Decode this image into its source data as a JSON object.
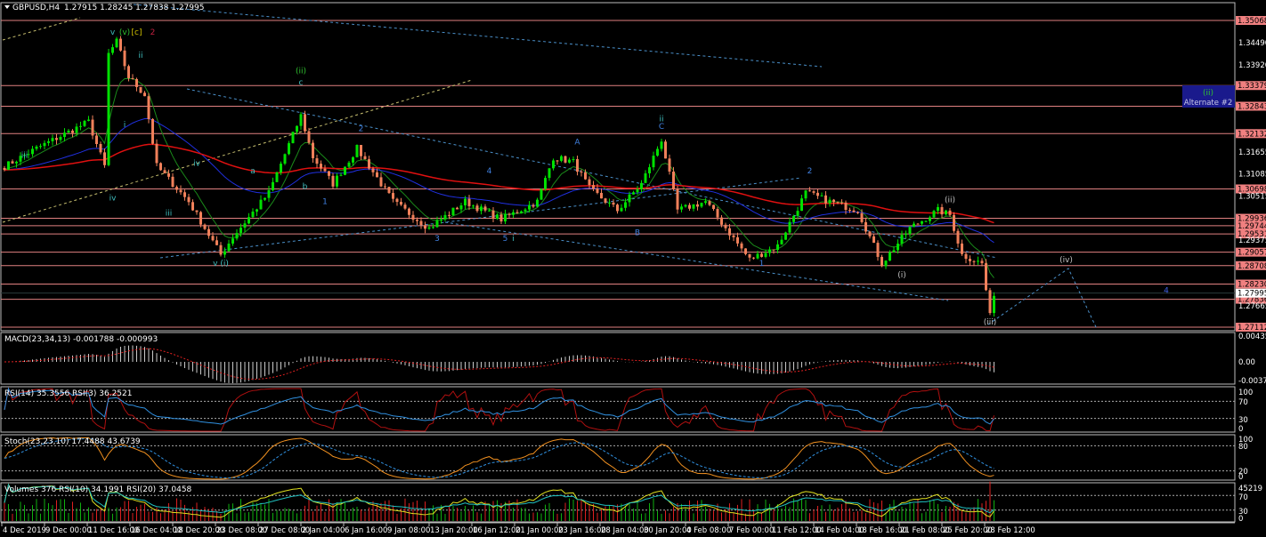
{
  "window": {
    "title": "GBPUSD,H4",
    "ohlc": "1.27915 1.28245 1.27838 1.27995",
    "menu_icon": "triangle-down-icon"
  },
  "colors": {
    "background": "#000000",
    "bull": "#00e000",
    "bear": "#f0805a",
    "level_line": "#e08080",
    "level_label_bg": "#f08080",
    "ma_fast": "#1a8a1a",
    "ma_mid": "#2030e0",
    "ma_slow": "#e01010",
    "alt_box": "#1a1a8c"
  },
  "chart_data": {
    "type": "candlestick",
    "symbol": "GBPUSD",
    "timeframe": "H4",
    "ylim": [
      1.27,
      1.356
    ],
    "price_waypoints": [
      [
        0,
        1.3128
      ],
      [
        8,
        1.3175
      ],
      [
        21,
        1.3244
      ],
      [
        25,
        1.3128
      ],
      [
        26,
        1.342
      ],
      [
        28,
        1.3452
      ],
      [
        31,
        1.336
      ],
      [
        35,
        1.3314
      ],
      [
        38,
        1.3129
      ],
      [
        46,
        1.3037
      ],
      [
        54,
        1.2899
      ],
      [
        57,
        1.2945
      ],
      [
        66,
        1.306
      ],
      [
        74,
        1.326
      ],
      [
        77,
        1.3152
      ],
      [
        82,
        1.3083
      ],
      [
        88,
        1.3175
      ],
      [
        97,
        1.3037
      ],
      [
        106,
        1.2968
      ],
      [
        115,
        1.3037
      ],
      [
        124,
        1.2991
      ],
      [
        133,
        1.3037
      ],
      [
        137,
        1.3152
      ],
      [
        142,
        1.314
      ],
      [
        146,
        1.3071
      ],
      [
        153,
        1.3014
      ],
      [
        159,
        1.3083
      ],
      [
        164,
        1.3198
      ],
      [
        168,
        1.3014
      ],
      [
        175,
        1.3037
      ],
      [
        186,
        1.2887
      ],
      [
        193,
        1.2922
      ],
      [
        200,
        1.306
      ],
      [
        206,
        1.3037
      ],
      [
        213,
        1.3014
      ],
      [
        219,
        1.2876
      ],
      [
        226,
        1.2968
      ],
      [
        233,
        1.3014
      ],
      [
        236,
        1.3002
      ],
      [
        239,
        1.2899
      ],
      [
        244,
        1.2876
      ],
      [
        246,
        1.2739
      ],
      [
        247,
        1.28
      ]
    ],
    "levels": [
      1.35068,
      1.33379,
      1.32843,
      1.32132,
      1.30698,
      1.29936,
      1.29744,
      1.29531,
      1.29057,
      1.28708,
      1.2823,
      1.27836,
      1.27112
    ],
    "current_price": 1.27995,
    "axis_ticks": [
      1.3449,
      1.3392,
      1.31655,
      1.31085,
      1.30515,
      1.29375,
      1.27665
    ],
    "wave_labels": [
      {
        "text": "v",
        "color": "#40c0c0",
        "bar": 27,
        "price": 1.347
      },
      {
        "text": "(v)",
        "color": "#30c030",
        "bar": 30,
        "price": 1.347
      },
      {
        "text": "[c]",
        "color": "#d0c000",
        "bar": 33,
        "price": 1.347
      },
      {
        "text": "2",
        "color": "#c02040",
        "bar": 37,
        "price": 1.347
      },
      {
        "text": "ii",
        "color": "#40c0c0",
        "bar": 34,
        "price": 1.341
      },
      {
        "text": "i",
        "color": "#40c0c0",
        "bar": 30,
        "price": 1.323
      },
      {
        "text": "iii",
        "color": "#40c0c0",
        "bar": 5,
        "price": 1.315
      },
      {
        "text": "iv",
        "color": "#40c0c0",
        "bar": 27,
        "price": 1.304
      },
      {
        "text": "iv",
        "color": "#40c0c0",
        "bar": 48,
        "price": 1.313
      },
      {
        "text": "iii",
        "color": "#40c0c0",
        "bar": 41,
        "price": 1.3
      },
      {
        "text": "v (i)",
        "color": "#40c0c0",
        "bar": 54,
        "price": 1.287
      },
      {
        "text": "(ii)",
        "color": "#30c030",
        "bar": 74,
        "price": 1.337
      },
      {
        "text": "c",
        "color": "#40c0c0",
        "bar": 74,
        "price": 1.334
      },
      {
        "text": "a",
        "color": "#40c0c0",
        "bar": 62,
        "price": 1.311
      },
      {
        "text": "b",
        "color": "#40c0c0",
        "bar": 75,
        "price": 1.307
      },
      {
        "text": "1",
        "color": "#4080e0",
        "bar": 80,
        "price": 1.303
      },
      {
        "text": "2",
        "color": "#4080e0",
        "bar": 89,
        "price": 1.322
      },
      {
        "text": "3",
        "color": "#4080e0",
        "bar": 108,
        "price": 1.2935
      },
      {
        "text": "4",
        "color": "#4080e0",
        "bar": 121,
        "price": 1.311
      },
      {
        "text": "5",
        "color": "#4080e0",
        "bar": 125,
        "price": 1.2935
      },
      {
        "text": "i",
        "color": "#40c0c0",
        "bar": 127,
        "price": 1.2935
      },
      {
        "text": "A",
        "color": "#4080e0",
        "bar": 143,
        "price": 1.3185
      },
      {
        "text": "B",
        "color": "#4080e0",
        "bar": 158,
        "price": 1.295
      },
      {
        "text": "ii",
        "color": "#40c0c0",
        "bar": 164,
        "price": 1.3245
      },
      {
        "text": "C",
        "color": "#4080e0",
        "bar": 164,
        "price": 1.3225
      },
      {
        "text": "1",
        "color": "#4080e0",
        "bar": 189,
        "price": 1.287
      },
      {
        "text": "2",
        "color": "#4080e0",
        "bar": 201,
        "price": 1.311
      },
      {
        "text": "(i)",
        "color": "#c0c0c0",
        "bar": 224,
        "price": 1.284
      },
      {
        "text": "(ii)",
        "color": "#c0c0c0",
        "bar": 236,
        "price": 1.3035
      },
      {
        "text": "(iii)",
        "color": "#c0c0c0",
        "bar": 246,
        "price": 1.2718
      },
      {
        "text": "(iv)",
        "color": "#c0c0c0",
        "bar": 265,
        "price": 1.288
      },
      {
        "text": "4",
        "color": "#4060e0",
        "bar": 290,
        "price": 1.28
      }
    ],
    "alternate_box": {
      "wave": "(ii)",
      "label": "Alternate #2"
    }
  },
  "indicators": {
    "macd": {
      "label": "MACD(23,34,13) -0.001788 -0.000993",
      "ticks": [
        "0.004354",
        "0.00",
        "-0.003767"
      ]
    },
    "rsi": {
      "label": "RSI(14) 35.3556  RSI(3) 36.2521",
      "ticks": [
        "100",
        "70",
        "30",
        "0"
      ]
    },
    "stoch": {
      "label": "Stoch(23,23,10) 17.4488 43.6739",
      "ticks": [
        "100",
        "80",
        "20",
        "0"
      ]
    },
    "volumes": {
      "label": "Volumes 376  RSI(10) 34.1991  RSI(20) 37.0458",
      "ticks": [
        "45219",
        "70",
        "30",
        "0"
      ]
    }
  },
  "time_axis": [
    "4 Dec 2019",
    "9 Dec 00:00",
    "11 Dec 16:00",
    "16 Dec 04:00",
    "18 Dec 20:00",
    "23 Dec 08:00",
    "27 Dec 08:00",
    "2 Jan 04:00",
    "6 Jan 16:00",
    "9 Jan 08:00",
    "13 Jan 20:00",
    "16 Jan 12:00",
    "21 Jan 00:00",
    "23 Jan 16:00",
    "28 Jan 04:00",
    "30 Jan 20:00",
    "4 Feb 08:00",
    "7 Feb 00:00",
    "11 Feb 12:00",
    "14 Feb 04:00",
    "18 Feb 16:00",
    "21 Feb 08:00",
    "25 Feb 20:00",
    "28 Feb 12:00"
  ]
}
